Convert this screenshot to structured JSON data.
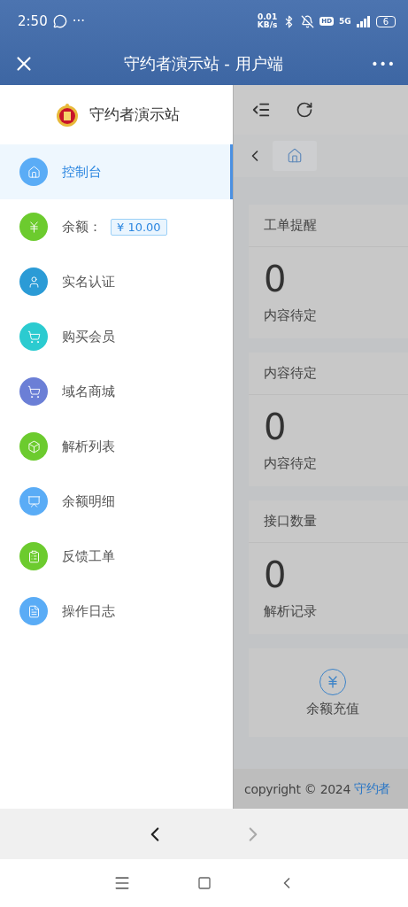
{
  "status_bar": {
    "time": "2:50",
    "more": "···",
    "net_speed": [
      "0.01",
      "KB/s"
    ],
    "hd": "HD",
    "network": "5G",
    "battery": "6"
  },
  "title_bar": {
    "title": "守约者演示站 - 用户端",
    "more": "•••"
  },
  "sidebar": {
    "brand": "守约者演示站",
    "items": [
      {
        "kind": "link",
        "label": "控制台",
        "color": "#5aacf6",
        "selected": true
      },
      {
        "kind": "balance",
        "label": "余额：",
        "badge": "¥ 10.00",
        "color": "#6ccb2e",
        "selected": false
      },
      {
        "kind": "link",
        "label": "实名认证",
        "color": "#2b9bd6",
        "selected": false
      },
      {
        "kind": "link",
        "label": "购买会员",
        "color": "#2bcbd0",
        "selected": false
      },
      {
        "kind": "link",
        "label": "域名商城",
        "color": "#6b7fd6",
        "selected": false
      },
      {
        "kind": "link",
        "label": "解析列表",
        "color": "#6ccb2e",
        "selected": false
      },
      {
        "kind": "link",
        "label": "余额明细",
        "color": "#5aacf6",
        "selected": false
      },
      {
        "kind": "link",
        "label": "反馈工单",
        "color": "#6ccb2e",
        "selected": false
      },
      {
        "kind": "link",
        "label": "操作日志",
        "color": "#5aacf6",
        "selected": false
      }
    ]
  },
  "main": {
    "cards": [
      {
        "title": "工单提醒",
        "value": "0",
        "caption": "内容待定"
      },
      {
        "title": "内容待定",
        "value": "0",
        "caption": "内容待定"
      },
      {
        "title": "接口数量",
        "value": "0",
        "caption": "解析记录"
      }
    ],
    "action": {
      "label": "余额充值"
    },
    "footer": {
      "text": "copyright © 2024",
      "link": "守约者"
    }
  }
}
